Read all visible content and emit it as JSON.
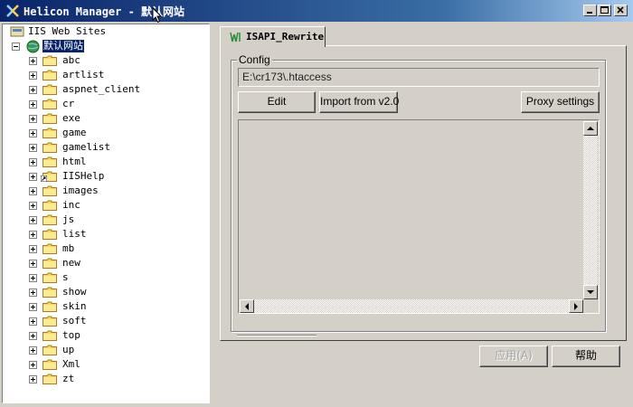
{
  "window": {
    "title": "Helicon Manager - 默认网站"
  },
  "tree": {
    "root_label": "IIS Web Sites",
    "site_label": "默认网站",
    "folders": [
      "abc",
      "artlist",
      "aspnet_client",
      "cr",
      "exe",
      "game",
      "gamelist",
      "html",
      "IISHelp",
      "images",
      "inc",
      "js",
      "list",
      "mb",
      "new",
      "s",
      "show",
      "skin",
      "soft",
      "top",
      "up",
      "Xml",
      "zt"
    ]
  },
  "tab": {
    "label": "ISAPI_Rewrite"
  },
  "config": {
    "legend": "Config",
    "path_value": "E:\\cr173\\.htaccess",
    "edit_label": "Edit",
    "import_label": "Import from v2.0",
    "proxy_label": "Proxy settings"
  },
  "footer": {
    "apply_label": "应用(A)",
    "help_label": "帮助"
  },
  "colors": {
    "titlebar_start": "#0a246a",
    "face": "#d4d0c8",
    "selection": "#0a246a"
  }
}
